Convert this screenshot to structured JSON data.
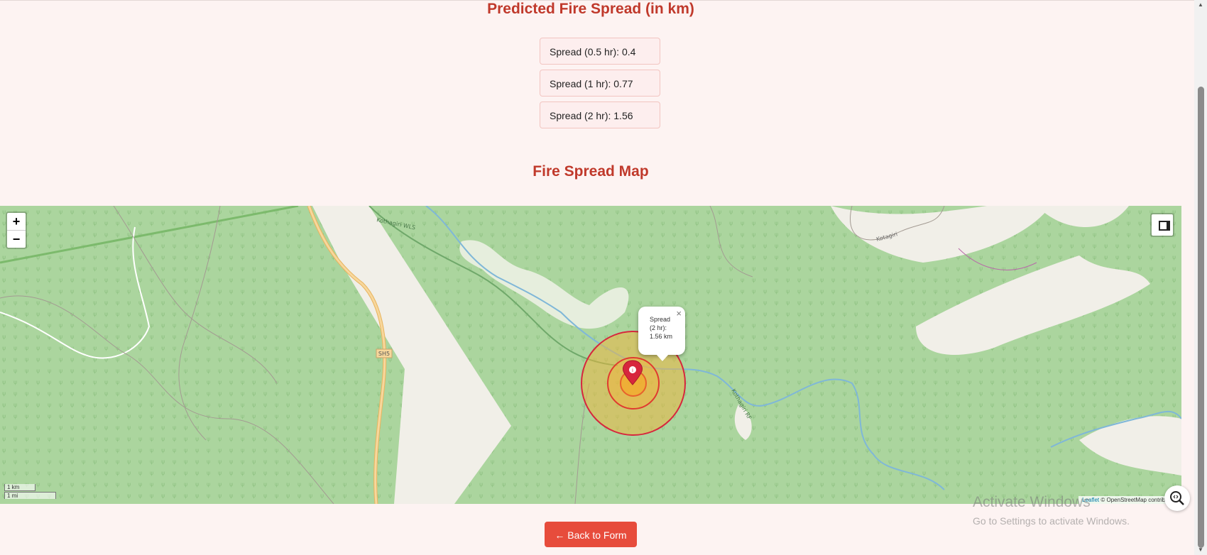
{
  "prediction": {
    "title": "Predicted Fire Spread (in km)",
    "spreads": [
      {
        "label": "Spread (0.5 hr): 0.4"
      },
      {
        "label": "Spread (1 hr): 0.77"
      },
      {
        "label": "Spread (2 hr): 1.56"
      }
    ]
  },
  "map_section": {
    "title": "Fire Spread Map",
    "zoom_in": "+",
    "zoom_out": "−",
    "popup": {
      "text": "Spread (2 hr): 1.56 km",
      "close": "×"
    },
    "road_label": "SH5",
    "scale": {
      "km": "1 km",
      "mi": "1 mi"
    },
    "attribution": {
      "leaflet": "Leaflet",
      "osm": "© OpenStreetMap contributors"
    },
    "place_labels": [
      "Kothagiri WLS",
      "Kotagiri",
      "Kothagiri RF"
    ],
    "colors": {
      "circle_stroke": "#d7263d",
      "circle_fill": "#f4b43a",
      "marker": "#d7263d"
    }
  },
  "actions": {
    "back_button": "← Back to Form"
  },
  "os_overlay": {
    "watermark_title": "Activate Windows",
    "watermark_sub": "Go to Settings to activate Windows."
  }
}
